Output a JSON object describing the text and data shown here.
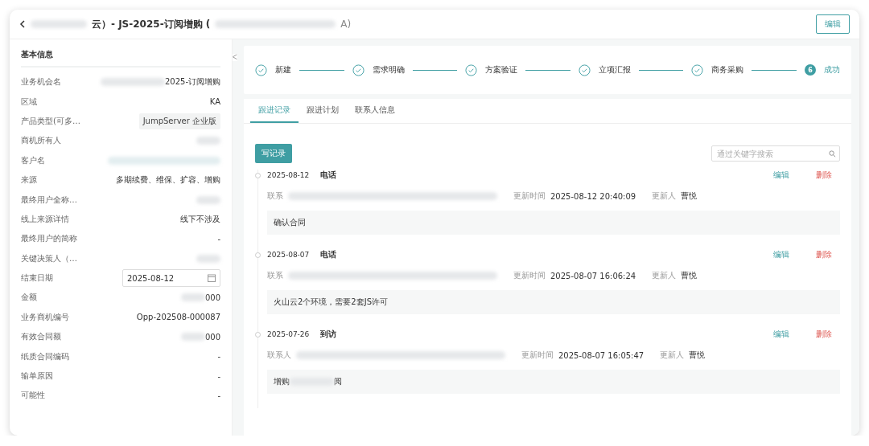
{
  "header": {
    "title_parts": [
      "云）- JS-2025-订阅增购 (",
      "A)"
    ],
    "edit_button": "编辑"
  },
  "info_panel": {
    "title": "基本信息",
    "fields": [
      {
        "label": "业务机会名",
        "kind": "redacted",
        "value": "2025-订阅增购"
      },
      {
        "label": "区域",
        "kind": "text",
        "value": "KA"
      },
      {
        "label": "产品类型(可多…",
        "kind": "tag",
        "value": "JumpServer 企业版"
      },
      {
        "label": "商机所有人",
        "kind": "redacted"
      },
      {
        "label": "客户名",
        "kind": "redacted"
      },
      {
        "label": "来源",
        "kind": "text",
        "value": "多期续费、维保、扩容、增购"
      },
      {
        "label": "最终用户全称…",
        "kind": "redacted"
      },
      {
        "label": "线上来源详情",
        "kind": "text",
        "value": "线下不涉及"
      },
      {
        "label": "最终用户的简称",
        "kind": "text",
        "value": "-"
      },
      {
        "label": "关键决策人（…",
        "kind": "redacted"
      },
      {
        "label": "结束日期",
        "kind": "date",
        "value": "2025-08-12"
      },
      {
        "label": "金额",
        "kind": "redacted",
        "value": "000"
      },
      {
        "label": "业务商机编号",
        "kind": "text",
        "value": "Opp-202508-000087"
      },
      {
        "label": "有效合同额",
        "kind": "redacted",
        "value": "000"
      },
      {
        "label": "纸质合同编码",
        "kind": "text",
        "value": "-"
      },
      {
        "label": "输单原因",
        "kind": "text",
        "value": "-"
      },
      {
        "label": "可能性",
        "kind": "text",
        "value": "-"
      }
    ]
  },
  "collapse_toggle": "ᐸ",
  "steps": [
    {
      "label": "新建",
      "completed": true
    },
    {
      "label": "需求明确",
      "completed": true
    },
    {
      "label": "方案验证",
      "completed": true
    },
    {
      "label": "立项汇报",
      "completed": true
    },
    {
      "label": "商务采购",
      "completed": true
    },
    {
      "label": "成功",
      "completed": false,
      "number": "6"
    }
  ],
  "tabs": [
    {
      "label": "跟进记录",
      "selected": true
    },
    {
      "label": "跟进计划",
      "selected": false
    },
    {
      "label": "联系人信息",
      "selected": false
    }
  ],
  "write_button": "写记录",
  "search": {
    "placeholder": "通过关键字搜索"
  },
  "records": [
    {
      "date": "2025-08-12",
      "type": "电话",
      "contact_label": "联系",
      "time_label": "更新时间",
      "time": "2025-08-12 20:40:09",
      "updater_label": "更新人",
      "updater": "曹悦",
      "note": [
        "确认合同"
      ],
      "edit": "编辑",
      "delete": "删除"
    },
    {
      "date": "2025-08-07",
      "type": "电话",
      "contact_label": "联系",
      "time_label": "更新时间",
      "time": "2025-08-07 16:06:24",
      "updater_label": "更新人",
      "updater": "曹悦",
      "note": [
        "火山云2个环境，需要2套JS许可"
      ],
      "edit": "编辑",
      "delete": "删除"
    },
    {
      "date": "2025-07-26",
      "type": "到访",
      "contact_label": "联系人",
      "time_label": "更新时间",
      "time": "2025-08-07 16:05:47",
      "updater_label": "更新人",
      "updater": "曹悦",
      "note": [
        "增购",
        "阅"
      ],
      "edit": "编辑",
      "delete": "删除"
    }
  ]
}
